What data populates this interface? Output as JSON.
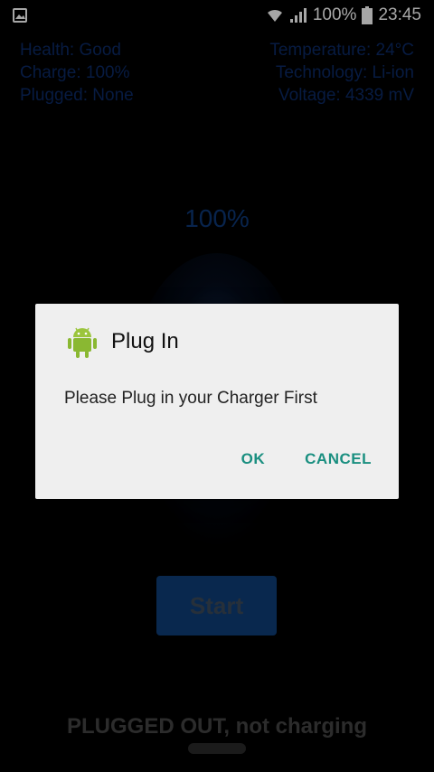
{
  "status_bar": {
    "battery_percent": "100%",
    "time": "23:45",
    "icons": [
      "gallery-icon",
      "wifi-icon",
      "signal-icon",
      "battery-icon"
    ]
  },
  "info_left": {
    "health": "Health: Good",
    "charge": "Charge: 100%",
    "plugged": "Plugged: None"
  },
  "info_right": {
    "temperature": "Temperature: 24°C",
    "technology": "Technology: Li-ion",
    "voltage": "Voltage: 4339 mV"
  },
  "main": {
    "percent": "100%",
    "start_label": "Start",
    "status_text": "PLUGGED OUT, not charging"
  },
  "dialog": {
    "title": "Plug In",
    "message": "Please Plug in your Charger First",
    "ok_label": "OK",
    "cancel_label": "CANCEL",
    "icon": "android-icon"
  },
  "colors": {
    "info_text": "#0c2a66",
    "dialog_action": "#1a8f80",
    "start_button": "#0e3e78"
  }
}
